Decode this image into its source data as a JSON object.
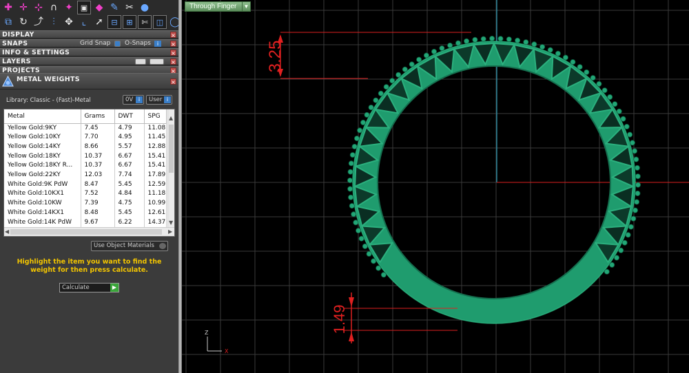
{
  "toolbar": {
    "row1_icons": [
      "move-plus-icon",
      "scale-plus-icon",
      "line-plus-icon",
      "curve-icon",
      "star-transform-icon",
      "snapshot-icon",
      "cube-icon",
      "pencil-icon",
      "ruler-icon",
      "sphere-icon"
    ],
    "row2_icons": [
      "boolean-icon",
      "arc-icon",
      "curve-edit-icon",
      "pattern-icon",
      "move-icon",
      "corner-icon",
      "arrow-up-icon",
      "mirror-icon",
      "align-icon",
      "scissors-icon",
      "offset-icon",
      "circle-icon"
    ]
  },
  "sections": {
    "display": "DISPLAY",
    "snaps": "SNAPS",
    "grid_snap": "Grid Snap",
    "osnaps": "O-Snaps",
    "info": "INFO & SETTINGS",
    "layers": "LAYERS",
    "projects": "PROJECTS",
    "metal_weights": "METAL WEIGHTS"
  },
  "library": {
    "label": "Library: Classic - (Fast)-Metal",
    "btn_ov": "0V",
    "btn_user": "User"
  },
  "table": {
    "headers": [
      "Metal",
      "Grams",
      "DWT",
      "SPG"
    ],
    "rows": [
      [
        "Yellow Gold:9KY",
        "7.45",
        "4.79",
        "11.08"
      ],
      [
        "Yellow Gold:10KY",
        "7.70",
        "4.95",
        "11.45"
      ],
      [
        "Yellow Gold:14KY",
        "8.66",
        "5.57",
        "12.88"
      ],
      [
        "Yellow Gold:18KY",
        "10.37",
        "6.67",
        "15.41"
      ],
      [
        "Yellow Gold:18KY R...",
        "10.37",
        "6.67",
        "15.41"
      ],
      [
        "Yellow Gold:22KY",
        "12.03",
        "7.74",
        "17.89"
      ],
      [
        "White Gold:9K PdW",
        "8.47",
        "5.45",
        "12.59"
      ],
      [
        "White Gold:10KX1",
        "7.52",
        "4.84",
        "11.18"
      ],
      [
        "White Gold:10KW",
        "7.39",
        "4.75",
        "10.99"
      ],
      [
        "White Gold:14KX1",
        "8.48",
        "5.45",
        "12.61"
      ],
      [
        "White Gold:14K PdW",
        "9.67",
        "6.22",
        "14.37"
      ]
    ]
  },
  "use_object_materials": "Use Object Materials",
  "hint": "Highlight the item you want to find the weight for then press calculate.",
  "calculate": "Calculate",
  "viewport": {
    "view_mode": "Through Finger",
    "dim_top": "3.25",
    "dim_bottom": "1.49",
    "axis_z": "Z",
    "axis_x": "X",
    "ring_color": "#1f9c6e",
    "dim_color": "#e02020",
    "grid_color": "#3a3a3a"
  }
}
